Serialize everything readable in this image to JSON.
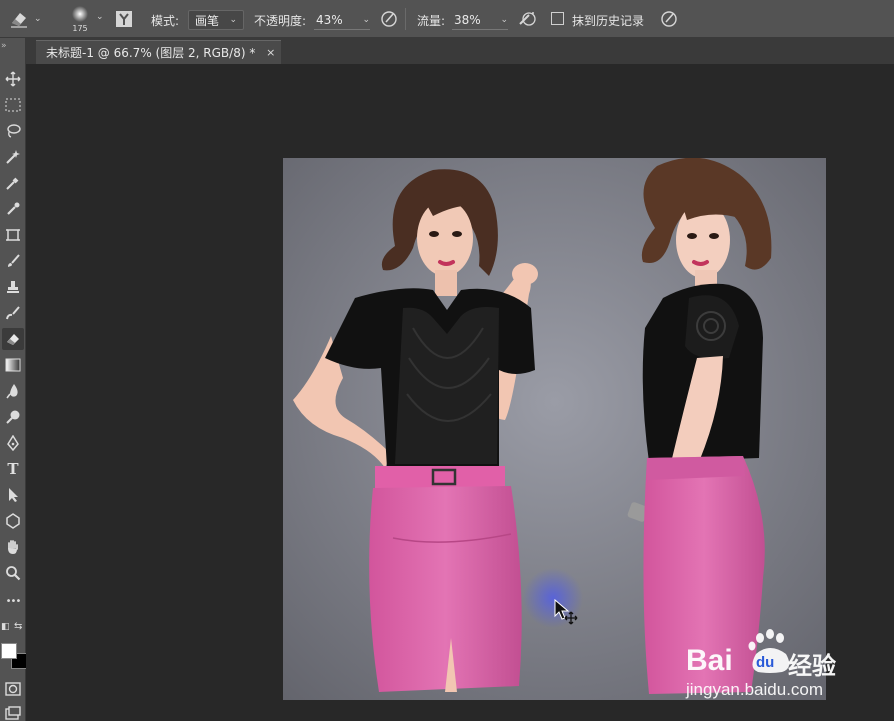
{
  "options_bar": {
    "brush_size": "175",
    "mode_label": "模式:",
    "mode_value": "画笔",
    "opacity_label": "不透明度:",
    "opacity_value": "43%",
    "flow_label": "流量:",
    "flow_value": "38%",
    "erase_history_label": "抹到历史记录"
  },
  "document_tab": {
    "title": "未标题-1 @ 66.7% (图层 2, RGB/8) *",
    "close": "×"
  },
  "toolbar": {
    "type_tool_glyph": "T",
    "more_glyph": "•••",
    "tools": [
      "move-icon",
      "rect-marquee-icon",
      "lasso-icon",
      "magic-wand-icon",
      "eyedropper-icon",
      "eyedropper-2-icon",
      "crop-icon",
      "brush-icon",
      "stamp-icon",
      "history-brush-icon",
      "eraser-icon",
      "gradient-icon",
      "blur-icon",
      "dodge-icon",
      "pen-icon",
      "type-icon",
      "path-select-icon",
      "shape-icon",
      "hand-icon",
      "zoom-icon"
    ]
  },
  "watermark": {
    "brand_left": "Bai",
    "brand_right": "经验",
    "du": "du",
    "url": "jingyan.baidu.com"
  }
}
